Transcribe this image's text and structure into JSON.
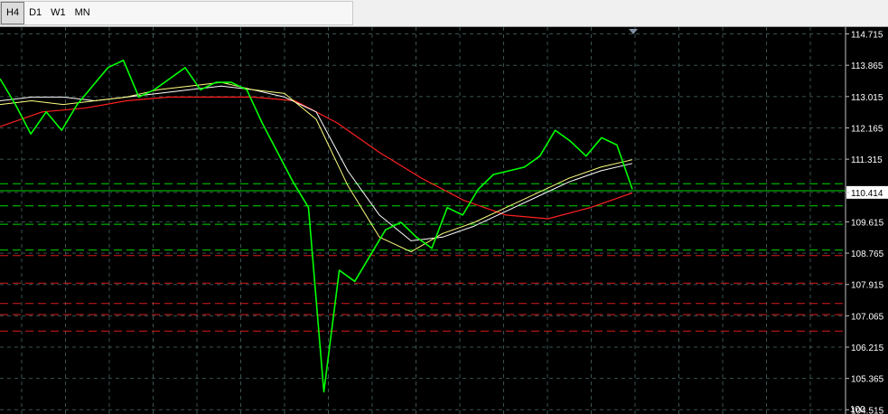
{
  "toolbar": {
    "timeframes": [
      {
        "label": "H4",
        "active": true
      },
      {
        "label": "D1",
        "active": false
      },
      {
        "label": "W1",
        "active": false
      },
      {
        "label": "MN",
        "active": false
      }
    ]
  },
  "chart": {
    "colors": {
      "background": "#000000",
      "grid": "#3a5252",
      "price_line": "#00ff00",
      "ma_fast": "#ffff80",
      "ma_mid": "#ffffff",
      "ma_slow": "#ff2020",
      "support_level": "#00ff00",
      "resistance_level": "#ff2020",
      "price_label_bg": "#ffffff",
      "price_label_text": "#000000"
    },
    "y_ticks": [
      "114.715",
      "113.865",
      "113.015",
      "112.165",
      "111.315",
      "110.414",
      "109.615",
      "108.765",
      "107.915",
      "107.065",
      "106.215",
      "105.365",
      "104.515"
    ],
    "current_price": "110.414",
    "bottom_label": "100"
  },
  "chart_data": {
    "type": "line",
    "ylim": [
      104.4,
      114.9
    ],
    "series": [
      {
        "values": [
          113.5,
          112.8,
          112.0,
          112.6,
          112.1,
          112.8,
          113.3,
          113.8,
          114.0,
          113.0,
          113.2,
          113.5,
          113.8,
          113.2,
          113.4,
          113.4,
          113.2,
          112.3,
          111.5,
          110.7,
          110.0,
          105.0,
          108.3,
          108.0,
          108.7,
          109.4,
          109.6,
          109.2,
          108.9,
          110.0,
          109.8,
          110.5,
          110.9,
          111.0,
          111.1,
          111.4,
          112.1,
          111.8,
          111.4,
          111.9,
          111.7,
          110.5
        ]
      },
      {
        "values": [
          112.8,
          112.9,
          112.8,
          112.9,
          113.0,
          113.2,
          113.3,
          113.4,
          113.2,
          113.1,
          112.4,
          110.6,
          109.2,
          108.8,
          109.3,
          109.6,
          110.0,
          110.4,
          110.8,
          111.1,
          111.3
        ]
      },
      {
        "values": [
          112.9,
          113.0,
          113.0,
          112.9,
          113.0,
          113.1,
          113.2,
          113.3,
          113.2,
          113.0,
          112.6,
          111.0,
          109.8,
          109.1,
          109.2,
          109.5,
          109.9,
          110.3,
          110.7,
          111.0,
          111.2
        ]
      },
      {
        "values": [
          112.2,
          112.6,
          112.7,
          112.9,
          113.0,
          113.0,
          113.0,
          112.9,
          112.3,
          111.5,
          110.8,
          110.2,
          109.8,
          109.7,
          110.0,
          110.4
        ]
      }
    ],
    "levels_green": [
      110.65,
      110.46,
      110.05,
      109.55,
      108.85
    ],
    "levels_red": [
      108.7,
      107.95,
      107.4,
      107.1,
      106.65
    ]
  }
}
